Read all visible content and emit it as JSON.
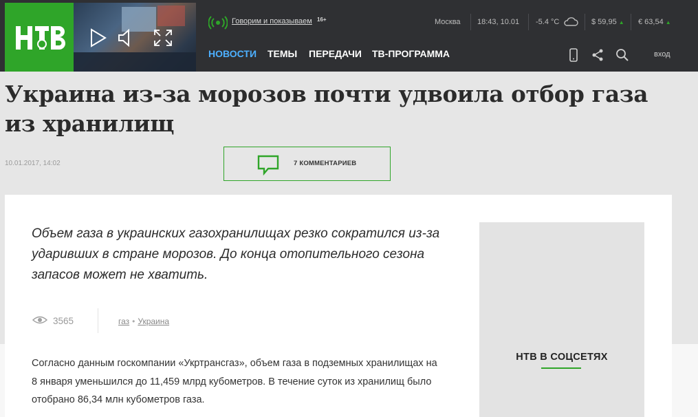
{
  "header": {
    "logo_text": "НТВ",
    "slogan": "Говорим и показываем",
    "age_rating": "16+",
    "city": "Москва",
    "time_date": "18:43, 10.01",
    "temperature": "-5.4 °C",
    "usd": "$ 59,95",
    "eur": "€ 63,54",
    "nav": [
      "НОВОСТИ",
      "ТЕМЫ",
      "ПЕРЕДАЧИ",
      "ТВ-ПРОГРАММА"
    ],
    "login": "вход"
  },
  "article": {
    "title": "Украина из-за морозов почти удвоила отбор газа из хранилищ",
    "date": "10.01.2017, 14:02",
    "comments_label": "7 КОММЕНТАРИЕВ",
    "lead": "Объем газа в украинских газохранилищах резко сократился из-за ударивших в стране морозов. До конца отопительного сезона запасов может не хватить.",
    "views": "3565",
    "tags": [
      "газ",
      "Украина"
    ],
    "body": "Согласно данным госкомпании «Укртрансгаз», объем газа в подземных хранилищах на 8 января уменьшился до 11,459 млрд кубометров. В течение суток из хранилищ было отобрано 86,34 млн кубометров газа."
  },
  "sidebar": {
    "social_title": "НТВ В СОЦСЕТЯХ"
  },
  "colors": {
    "brand_green": "#2fa529",
    "header_bg": "#2f3033",
    "nav_active": "#4db0ff"
  },
  "icons": [
    "play-icon",
    "volume-icon",
    "fullscreen-icon",
    "live-broadcast-icon",
    "cloud-icon",
    "mobile-icon",
    "share-icon",
    "search-icon",
    "comment-icon",
    "eye-icon"
  ]
}
